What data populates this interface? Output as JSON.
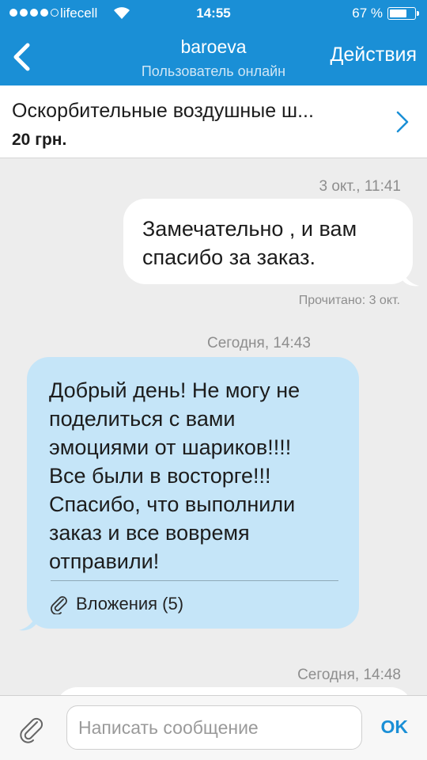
{
  "status_bar": {
    "carrier": "lifecell",
    "time": "14:55",
    "battery_pct": "67 %",
    "battery_level": 0.67
  },
  "nav": {
    "title": "baroeva",
    "subtitle": "Пользователь онлайн",
    "actions_label": "Действия"
  },
  "product": {
    "title": "Оскорбительные воздушные ш...",
    "price": "20 грн."
  },
  "messages": [
    {
      "timestamp": "3 окт., 11:41",
      "direction": "outgoing",
      "lines": [
        "Замечательно , и вам",
        "спасибо за заказ."
      ],
      "read_status": "Прочитано: 3 окт."
    },
    {
      "timestamp": "Сегодня, 14:43",
      "direction": "incoming",
      "lines": [
        "Добрый день! Не могу не",
        "поделиться с вами",
        "эмоциями от шариков!!!!",
        "Все были в восторге!!!",
        "Спасибо, что выполнили",
        "заказ и все вовремя",
        "отправили!"
      ],
      "attachments_label": "Вложения (5)"
    },
    {
      "timestamp": "Сегодня, 14:48",
      "direction": "outgoing"
    }
  ],
  "input": {
    "placeholder": "Написать сообщение",
    "send_label": "OK"
  },
  "colors": {
    "accent": "#1a8fd6",
    "incoming_bubble": "#c5e5f8",
    "outgoing_bubble": "#ffffff",
    "background": "#ededed"
  }
}
